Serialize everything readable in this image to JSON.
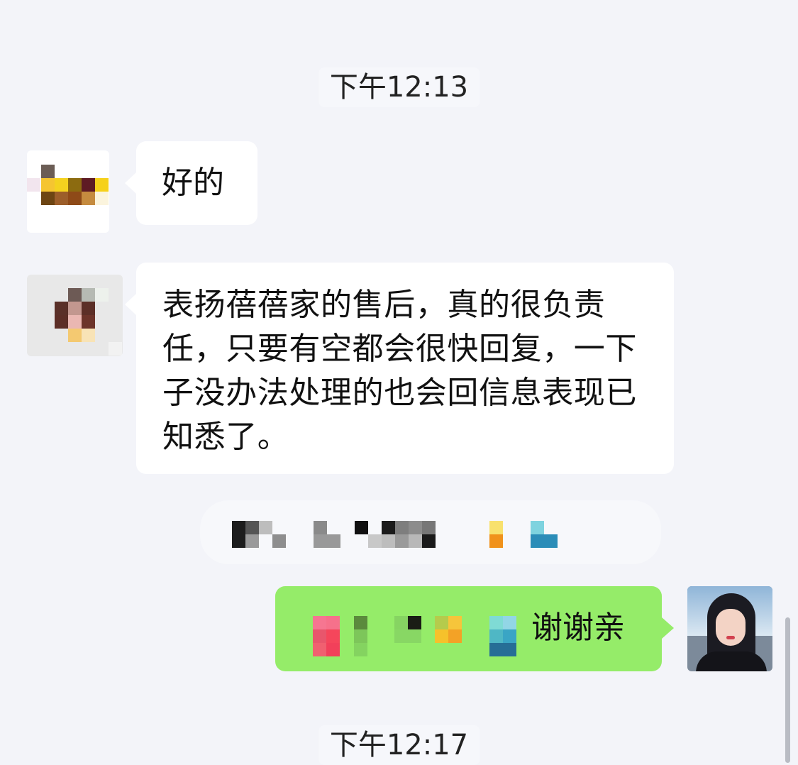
{
  "chat": {
    "timestamps": [
      "下午12:13",
      "下午12:17"
    ],
    "messages": [
      {
        "sender": "other",
        "text": "好的"
      },
      {
        "sender": "other",
        "text": "表扬蓓蓓家的售后，真的很负责任，只要有空都会很快回复，一下子没办法处理的也会回信息表现已知悉了。"
      },
      {
        "sender": "self",
        "text": "谢谢亲"
      }
    ]
  },
  "colors": {
    "background": "#f3f4f9",
    "incoming_bubble": "#ffffff",
    "outgoing_bubble": "#95ec69"
  }
}
